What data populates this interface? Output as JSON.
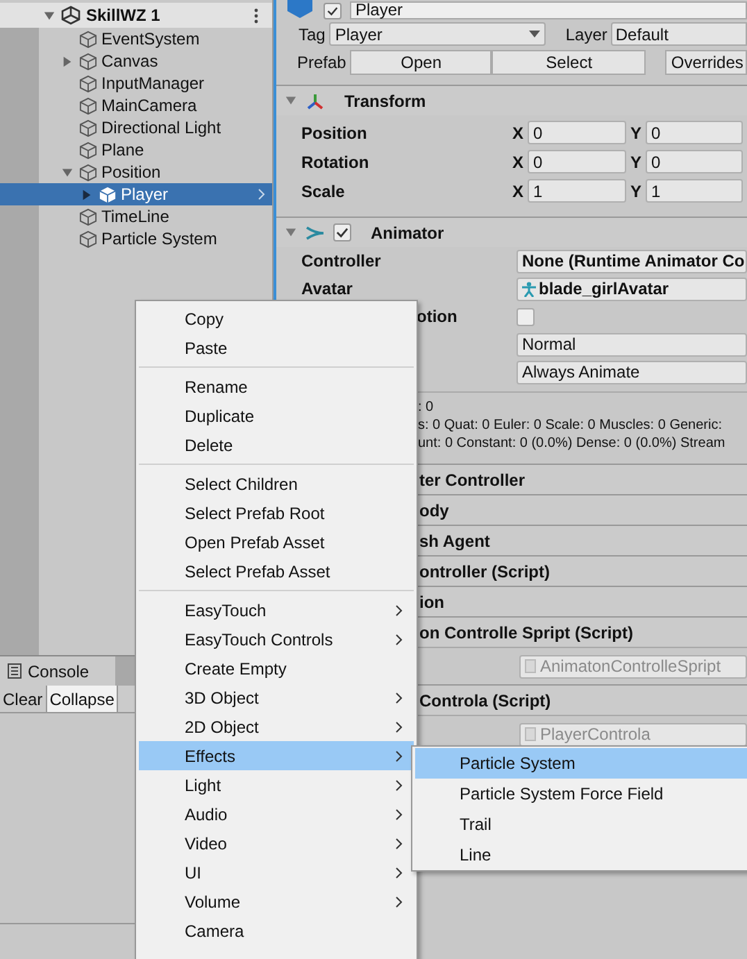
{
  "hierarchy": {
    "scene": "SkillWZ 1",
    "expanded": true,
    "items": [
      {
        "label": "EventSystem",
        "selected": false
      },
      {
        "label": "Canvas",
        "selected": false,
        "expanded": false
      },
      {
        "label": "InputManager",
        "selected": false
      },
      {
        "label": "MainCamera",
        "selected": false
      },
      {
        "label": "Directional Light",
        "selected": false
      },
      {
        "label": "Plane",
        "selected": false
      },
      {
        "label": "Position",
        "selected": false,
        "expanded": true,
        "children": [
          {
            "label": "Player",
            "selected": true,
            "expanded": false,
            "prefab": true
          }
        ]
      },
      {
        "label": "TimeLine",
        "selected": false
      },
      {
        "label": "Particle System",
        "selected": false
      }
    ]
  },
  "console": {
    "tab": "Console",
    "buttons": [
      {
        "label": "Clear",
        "selected": false
      },
      {
        "label": "Collapse",
        "selected": true
      }
    ]
  },
  "inspector": {
    "object": {
      "name": "Player",
      "active": true,
      "tag_label": "Tag",
      "tag": "Player",
      "layer_label": "Layer",
      "layer": "Default",
      "prefab_label": "Prefab",
      "prefab_buttons": [
        "Open",
        "Select",
        "Overrides"
      ]
    },
    "transform": {
      "title": "Transform",
      "expanded": true,
      "rows": [
        {
          "label": "Position",
          "values": [
            {
              "axis": "X",
              "value": "0"
            },
            {
              "axis": "Y",
              "value": "0"
            }
          ]
        },
        {
          "label": "Rotation",
          "values": [
            {
              "axis": "X",
              "value": "0"
            },
            {
              "axis": "Y",
              "value": "0"
            }
          ]
        },
        {
          "label": "Scale",
          "values": [
            {
              "axis": "X",
              "value": "1"
            },
            {
              "axis": "Y",
              "value": "1"
            }
          ]
        }
      ]
    },
    "animator": {
      "title": "Animator",
      "expanded": true,
      "enabled": true,
      "fields": [
        {
          "kind": "object",
          "label": "Controller",
          "value": "None (Runtime Animator Co"
        },
        {
          "kind": "avatar",
          "label": "Avatar",
          "value": "blade_girlAvatar"
        },
        {
          "kind": "checkbox",
          "label": "otion",
          "checked": false
        },
        {
          "kind": "dropdown",
          "value": "Normal"
        },
        {
          "kind": "dropdown",
          "value": "Always Animate"
        }
      ],
      "info": [
        ": 0",
        "s: 0 Quat: 0 Euler: 0 Scale: 0 Muscles: 0 Generic:",
        "unt: 0 Constant: 0 (0.0%) Dense: 0 (0.0%) Stream"
      ]
    },
    "components": [
      {
        "title": "ter Controller"
      },
      {
        "title": "ody"
      },
      {
        "title": "sh Agent"
      },
      {
        "title": "ontroller (Script)"
      },
      {
        "title": "ion"
      },
      {
        "title": "on Controlle Spript (Script)",
        "script": "AnimatonControlleSpript"
      },
      {
        "title": "Controla (Script)",
        "script": "PlayerControla"
      }
    ]
  },
  "context_menu": {
    "groups": [
      [
        {
          "label": "Copy",
          "submenu": false,
          "selected": false
        },
        {
          "label": "Paste",
          "submenu": false,
          "selected": false
        }
      ],
      [
        {
          "label": "Rename",
          "submenu": false,
          "selected": false
        },
        {
          "label": "Duplicate",
          "submenu": false,
          "selected": false
        },
        {
          "label": "Delete",
          "submenu": false,
          "selected": false
        }
      ],
      [
        {
          "label": "Select Children",
          "submenu": false,
          "selected": false
        },
        {
          "label": "Select Prefab Root",
          "submenu": false,
          "selected": false
        },
        {
          "label": "Open Prefab Asset",
          "submenu": false,
          "selected": false
        },
        {
          "label": "Select Prefab Asset",
          "submenu": false,
          "selected": false
        }
      ],
      [
        {
          "label": "EasyTouch",
          "submenu": true,
          "selected": false
        },
        {
          "label": "EasyTouch Controls",
          "submenu": true,
          "selected": false
        },
        {
          "label": "Create Empty",
          "submenu": false,
          "selected": false
        },
        {
          "label": "3D Object",
          "submenu": true,
          "selected": false
        },
        {
          "label": "2D Object",
          "submenu": true,
          "selected": false
        },
        {
          "label": "Effects",
          "submenu": true,
          "selected": true
        },
        {
          "label": "Light",
          "submenu": true,
          "selected": false
        },
        {
          "label": "Audio",
          "submenu": true,
          "selected": false
        },
        {
          "label": "Video",
          "submenu": true,
          "selected": false
        },
        {
          "label": "UI",
          "submenu": true,
          "selected": false
        },
        {
          "label": "Volume",
          "submenu": true,
          "selected": false
        },
        {
          "label": "Camera",
          "submenu": false,
          "selected": false
        }
      ]
    ],
    "submenu": [
      {
        "label": "Particle System",
        "selected": true
      },
      {
        "label": "Particle System Force Field",
        "selected": false
      },
      {
        "label": "Trail",
        "selected": false
      },
      {
        "label": "Line",
        "selected": false
      }
    ]
  }
}
